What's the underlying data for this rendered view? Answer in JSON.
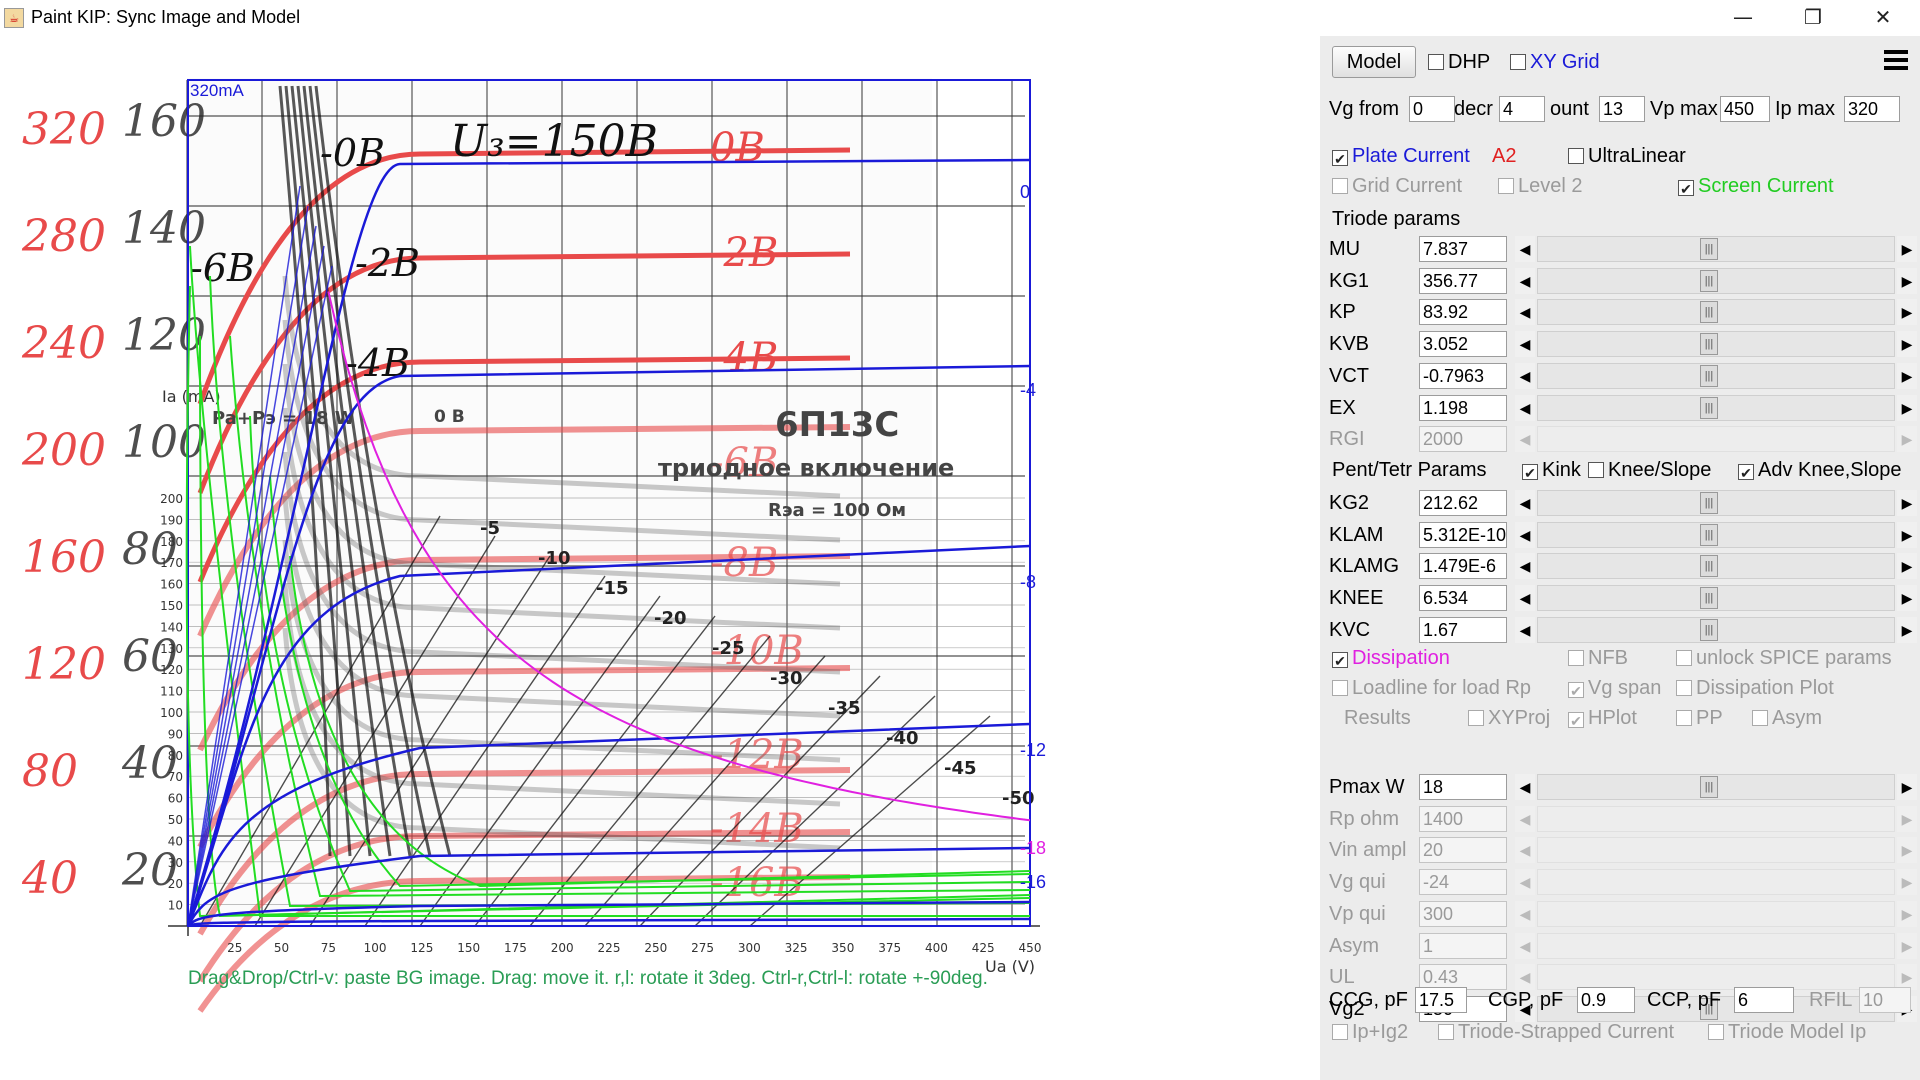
{
  "window": {
    "title": "Paint KIP: Sync Image and Model",
    "minimize_glyph": "—",
    "maximize_glyph": "❐",
    "close_glyph": "✕"
  },
  "toolbar": {
    "model_button": "Model",
    "dhp_label": "DHP",
    "dhp_checked": false,
    "xygrid_label": "XY Grid",
    "xygrid_checked": false,
    "menu_icon": "hamburger-menu-icon"
  },
  "range": {
    "vg_from_label": "Vg from",
    "vg_from_value": "0",
    "decr_label": "decr",
    "decr_value": "4",
    "count_label": "ount",
    "count_value": "13",
    "vp_max_label": "Vp max",
    "vp_max_value": "450",
    "ip_max_label": "Ip max",
    "ip_max_value": "320"
  },
  "options": {
    "plate_current": "Plate Current",
    "plate_current_checked": true,
    "a2_label": "A2",
    "ultralinear": "UltraLinear",
    "ultralinear_checked": false,
    "grid_current": "Grid Current",
    "level2": "Level 2",
    "screen_current": "Screen Current",
    "screen_current_checked": true,
    "triode_params_label": "Triode params"
  },
  "triode_params": [
    {
      "name": "MU",
      "value": "7.837"
    },
    {
      "name": "KG1",
      "value": "356.77"
    },
    {
      "name": "KP",
      "value": "83.92"
    },
    {
      "name": "KVB",
      "value": "3.052"
    },
    {
      "name": "VCT",
      "value": "-0.7963"
    },
    {
      "name": "EX",
      "value": "1.198"
    },
    {
      "name": "RGI",
      "value": "2000"
    }
  ],
  "pent": {
    "label": "Pent/Tetr Params",
    "kink": "Kink",
    "kink_checked": true,
    "knee_slope": "Knee/Slope",
    "knee_slope_checked": false,
    "adv_knee": "Adv Knee,Slope",
    "adv_knee_checked": true
  },
  "pent_params": [
    {
      "name": "KG2",
      "value": "212.62"
    },
    {
      "name": "KLAM",
      "value": "5.312E-10"
    },
    {
      "name": "KLAMG",
      "value": "1.479E-6"
    },
    {
      "name": "KNEE",
      "value": "6.534"
    },
    {
      "name": "KVC",
      "value": "1.67"
    }
  ],
  "flags": {
    "dissipation": "Dissipation",
    "dissipation_checked": true,
    "nfb": "NFB",
    "unlock_spice": "unlock SPICE params",
    "loadline": "Loadline for load Rp",
    "loadline_checked": false,
    "vg_span": "Vg span",
    "vg_span_checked": true,
    "dissipation_plot": "Dissipation Plot",
    "dissipation_plot_checked": false,
    "results": "Results",
    "xyproj": "XYProj",
    "hplot": "HPlot",
    "hplot_checked": true,
    "pp": "PP",
    "asym_chk": "Asym"
  },
  "load_params": [
    {
      "name": "Pmax W",
      "value": "18"
    },
    {
      "name": "Rp ohm",
      "value": "1400"
    },
    {
      "name": "Vin ampl",
      "value": "20"
    },
    {
      "name": "Vg qui",
      "value": "-24"
    },
    {
      "name": "Vp qui",
      "value": "300"
    },
    {
      "name": "Asym",
      "value": "1"
    },
    {
      "name": "UL",
      "value": "0.43"
    },
    {
      "name": "Vg2",
      "value": "150"
    }
  ],
  "caps": {
    "ccg_label": "CCG, pF",
    "ccg_value": "17.5",
    "cgp_label": "CGP, pF",
    "cgp_value": "0.9",
    "ccp_label": "CCP, pF",
    "ccp_value": "6",
    "rfil_label": "RFIL",
    "rfil_value": "10"
  },
  "bottom": {
    "ip_ig2": "Ip+Ig2",
    "triode_strapped": "Triode-Strapped Current",
    "triode_model_ip": "Triode Model Ip"
  },
  "plot": {
    "status": "Drag&Drop/Ctrl-v: paste BG image. Drag: move it. r,l: rotate it 3deg. Ctrl-r,Ctrl-l: rotate +-90deg.",
    "ip_max_label": "320mA",
    "vg_curve_labels": [
      "0",
      "-4",
      "-8",
      "-12",
      "-16",
      "-18"
    ],
    "axis_ia_label": "Ia (mA)",
    "axis_ua_label": "Ua (V)",
    "x_ticks": [
      "25",
      "50",
      "75",
      "100",
      "125",
      "150",
      "175",
      "200",
      "225",
      "250",
      "275",
      "300",
      "325",
      "350",
      "375",
      "400",
      "425",
      "450"
    ],
    "y_ticks": [
      "10",
      "20",
      "30",
      "40",
      "50",
      "60",
      "70",
      "80",
      "90",
      "100",
      "110",
      "120",
      "130",
      "140",
      "150",
      "160",
      "170",
      "180",
      "190",
      "200"
    ],
    "bg_red_numbers": [
      "320",
      "280",
      "240",
      "200",
      "160",
      "120",
      "80",
      "40"
    ],
    "bg_black_numbers": [
      "160",
      "140",
      "120",
      "100",
      "80",
      "60",
      "40",
      "20"
    ],
    "bg_tube_name": "6П13С",
    "bg_mode_text": "триодное включение",
    "bg_rsa_text": "Rэа = 100 Ом",
    "bg_pa_text": "Pa+Pэ = 18 W",
    "bg_ob_text": "0 B",
    "bg_u3_text": "U₃=150B",
    "bg_red_curve_labels": [
      "0B",
      "-2B",
      "-4B",
      "-6B",
      "-8B",
      "-10B",
      "-12B",
      "-14B",
      "-16B"
    ],
    "bg_black_curve_labels": [
      "-5",
      "-10",
      "-15",
      "-20",
      "-25",
      "-30",
      "-35",
      "-40",
      "-45",
      "-50"
    ],
    "bg_left_labels": [
      "-0B",
      "-6B",
      "-2B",
      "-4B"
    ],
    "colors": {
      "plate": "#1a1ad8",
      "screen": "#22dd22",
      "dissipation": "#e020e0",
      "bg_red": "#e84a4a"
    }
  }
}
